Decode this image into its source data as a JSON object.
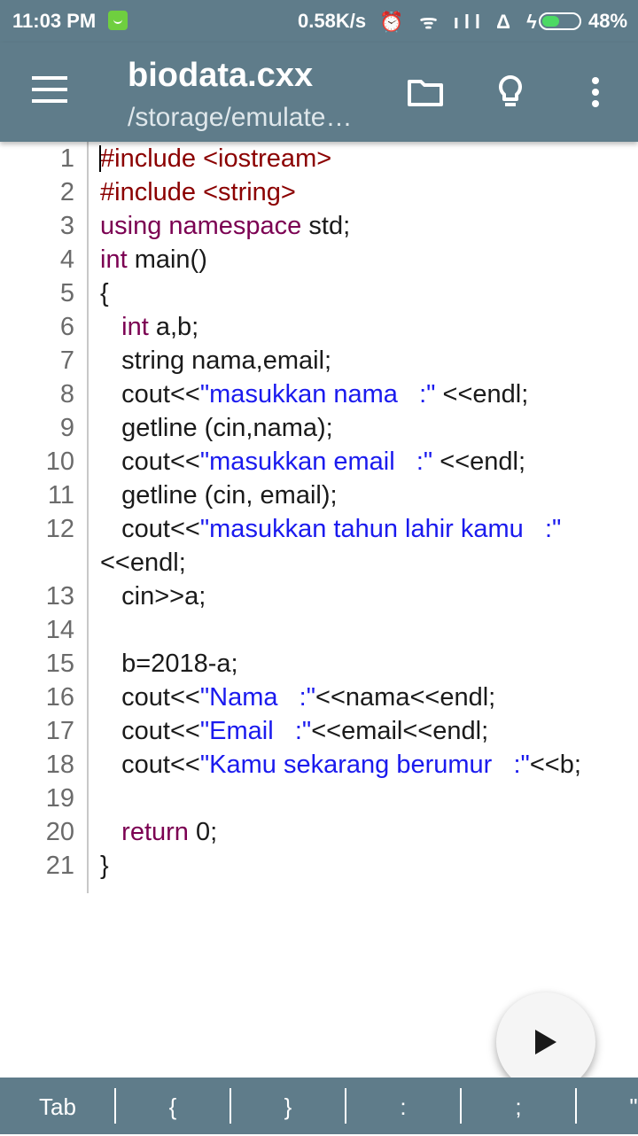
{
  "status_bar": {
    "time": "11:03 PM",
    "network_speed": "0.58K/s",
    "icons": "⏰ ᯤ ıll Δ ϟ",
    "battery_level": 0.48,
    "battery_text": "48%"
  },
  "toolbar": {
    "title": "biodata.cxx",
    "subtitle": "/storage/emulate…",
    "icons": [
      "menu-icon",
      "folder-icon",
      "lightbulb-icon",
      "more-vert-icon"
    ]
  },
  "editor": {
    "lines": [
      {
        "n": "1",
        "tokens": [
          {
            "t": "#include <iostream>",
            "c": "#8b0000"
          }
        ]
      },
      {
        "n": "2",
        "tokens": [
          {
            "t": "#include <string>",
            "c": "#8b0000"
          }
        ]
      },
      {
        "n": "3",
        "tokens": [
          {
            "t": "using namespace",
            "c": "#7b0052"
          },
          {
            "t": " std;",
            "c": "#1a1a1a"
          }
        ]
      },
      {
        "n": "4",
        "tokens": [
          {
            "t": "int",
            "c": "#7b0052"
          },
          {
            "t": " main()",
            "c": "#1a1a1a"
          }
        ]
      },
      {
        "n": "5",
        "tokens": [
          {
            "t": "{",
            "c": "#1a1a1a"
          }
        ]
      },
      {
        "n": "6",
        "tokens": [
          {
            "t": "   ",
            "c": "#1a1a1a"
          },
          {
            "t": "int",
            "c": "#7b0052"
          },
          {
            "t": " a,b;",
            "c": "#1a1a1a"
          }
        ]
      },
      {
        "n": "7",
        "tokens": [
          {
            "t": "   string nama,email;",
            "c": "#1a1a1a"
          }
        ]
      },
      {
        "n": "8",
        "tokens": [
          {
            "t": "   cout<<",
            "c": "#1a1a1a"
          },
          {
            "t": "\"masukkan nama   :\"",
            "c": "#1a1aee"
          },
          {
            "t": " <<endl;",
            "c": "#1a1a1a"
          }
        ]
      },
      {
        "n": "9",
        "tokens": [
          {
            "t": "   getline (cin,nama);",
            "c": "#1a1a1a"
          }
        ]
      },
      {
        "n": "10",
        "tokens": [
          {
            "t": "   cout<<",
            "c": "#1a1a1a"
          },
          {
            "t": "\"masukkan email   :\"",
            "c": "#1a1aee"
          },
          {
            "t": " <<endl;",
            "c": "#1a1a1a"
          }
        ]
      },
      {
        "n": "11",
        "tokens": [
          {
            "t": "   getline (cin, email);",
            "c": "#1a1a1a"
          }
        ]
      },
      {
        "n": "12",
        "tokens": [
          {
            "t": "   cout<<",
            "c": "#1a1a1a"
          },
          {
            "t": "\"masukkan tahun lahir kamu   :\"",
            "c": "#1a1aee"
          }
        ]
      },
      {
        "n": "",
        "tokens": [
          {
            "t": "<<endl;",
            "c": "#1a1a1a"
          }
        ]
      },
      {
        "n": "13",
        "tokens": [
          {
            "t": "   cin>>a;",
            "c": "#1a1a1a"
          }
        ]
      },
      {
        "n": "14",
        "tokens": []
      },
      {
        "n": "15",
        "tokens": [
          {
            "t": "   b=2018-a;",
            "c": "#1a1a1a"
          }
        ]
      },
      {
        "n": "16",
        "tokens": [
          {
            "t": "   cout<<",
            "c": "#1a1a1a"
          },
          {
            "t": "\"Nama   :\"",
            "c": "#1a1aee"
          },
          {
            "t": "<<nama<<endl;",
            "c": "#1a1a1a"
          }
        ]
      },
      {
        "n": "17",
        "tokens": [
          {
            "t": "   cout<<",
            "c": "#1a1a1a"
          },
          {
            "t": "\"Email   :\"",
            "c": "#1a1aee"
          },
          {
            "t": "<<email<<endl;",
            "c": "#1a1a1a"
          }
        ]
      },
      {
        "n": "18",
        "tokens": [
          {
            "t": "   cout<<",
            "c": "#1a1a1a"
          },
          {
            "t": "\"Kamu sekarang berumur   :\"",
            "c": "#1a1aee"
          },
          {
            "t": "<<b;",
            "c": "#1a1a1a"
          }
        ]
      },
      {
        "n": "19",
        "tokens": []
      },
      {
        "n": "20",
        "tokens": [
          {
            "t": "   ",
            "c": "#1a1a1a"
          },
          {
            "t": "return",
            "c": "#7b0052"
          },
          {
            "t": " 0;",
            "c": "#1a1a1a"
          }
        ]
      },
      {
        "n": "21",
        "tokens": [
          {
            "t": "}",
            "c": "#1a1a1a"
          }
        ]
      }
    ]
  },
  "run_button": {
    "icon": "play-icon"
  },
  "key_bar": {
    "keys": [
      "Tab",
      "{",
      "}",
      ":",
      ";",
      "\""
    ]
  },
  "colors": {
    "toolbar_bg": "#5f7c8a",
    "preprocessor": "#8b0000",
    "keyword": "#7b0052",
    "string": "#1a1aee",
    "text": "#1a1a1a"
  }
}
